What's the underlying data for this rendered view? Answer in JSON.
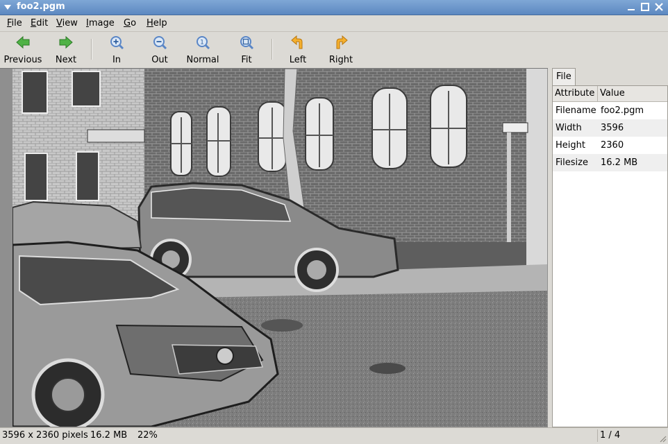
{
  "window": {
    "title": "foo2.pgm"
  },
  "menu": [
    {
      "label": "File",
      "u": "F",
      "rest": "ile"
    },
    {
      "label": "Edit",
      "u": "E",
      "rest": "dit"
    },
    {
      "label": "View",
      "u": "V",
      "rest": "iew"
    },
    {
      "label": "Image",
      "u": "I",
      "rest": "mage"
    },
    {
      "label": "Go",
      "u": "G",
      "rest": "o"
    },
    {
      "label": "Help",
      "u": "H",
      "rest": "elp"
    }
  ],
  "toolbar": {
    "previous": "Previous",
    "next": "Next",
    "zoom_in": "In",
    "zoom_out": "Out",
    "zoom_normal": "Normal",
    "zoom_fit": "Fit",
    "rotate_left": "Left",
    "rotate_right": "Right"
  },
  "panel": {
    "tab": "File",
    "headers": {
      "attribute": "Attribute",
      "value": "Value"
    },
    "rows": [
      {
        "attribute": "Filename",
        "value": "foo2.pgm"
      },
      {
        "attribute": "Width",
        "value": "3596"
      },
      {
        "attribute": "Height",
        "value": "2360"
      },
      {
        "attribute": "Filesize",
        "value": "16.2 MB"
      }
    ]
  },
  "status": {
    "dimensions": "3596 x 2360 pixels",
    "filesize": "16.2 MB",
    "zoom": "22%",
    "position": "1 / 4"
  },
  "colors": {
    "titlebar": "#5c88c1",
    "arrow_green": "#3fa33a",
    "rotate_orange": "#f0a020",
    "zoom_blue": "#5a86c6"
  }
}
